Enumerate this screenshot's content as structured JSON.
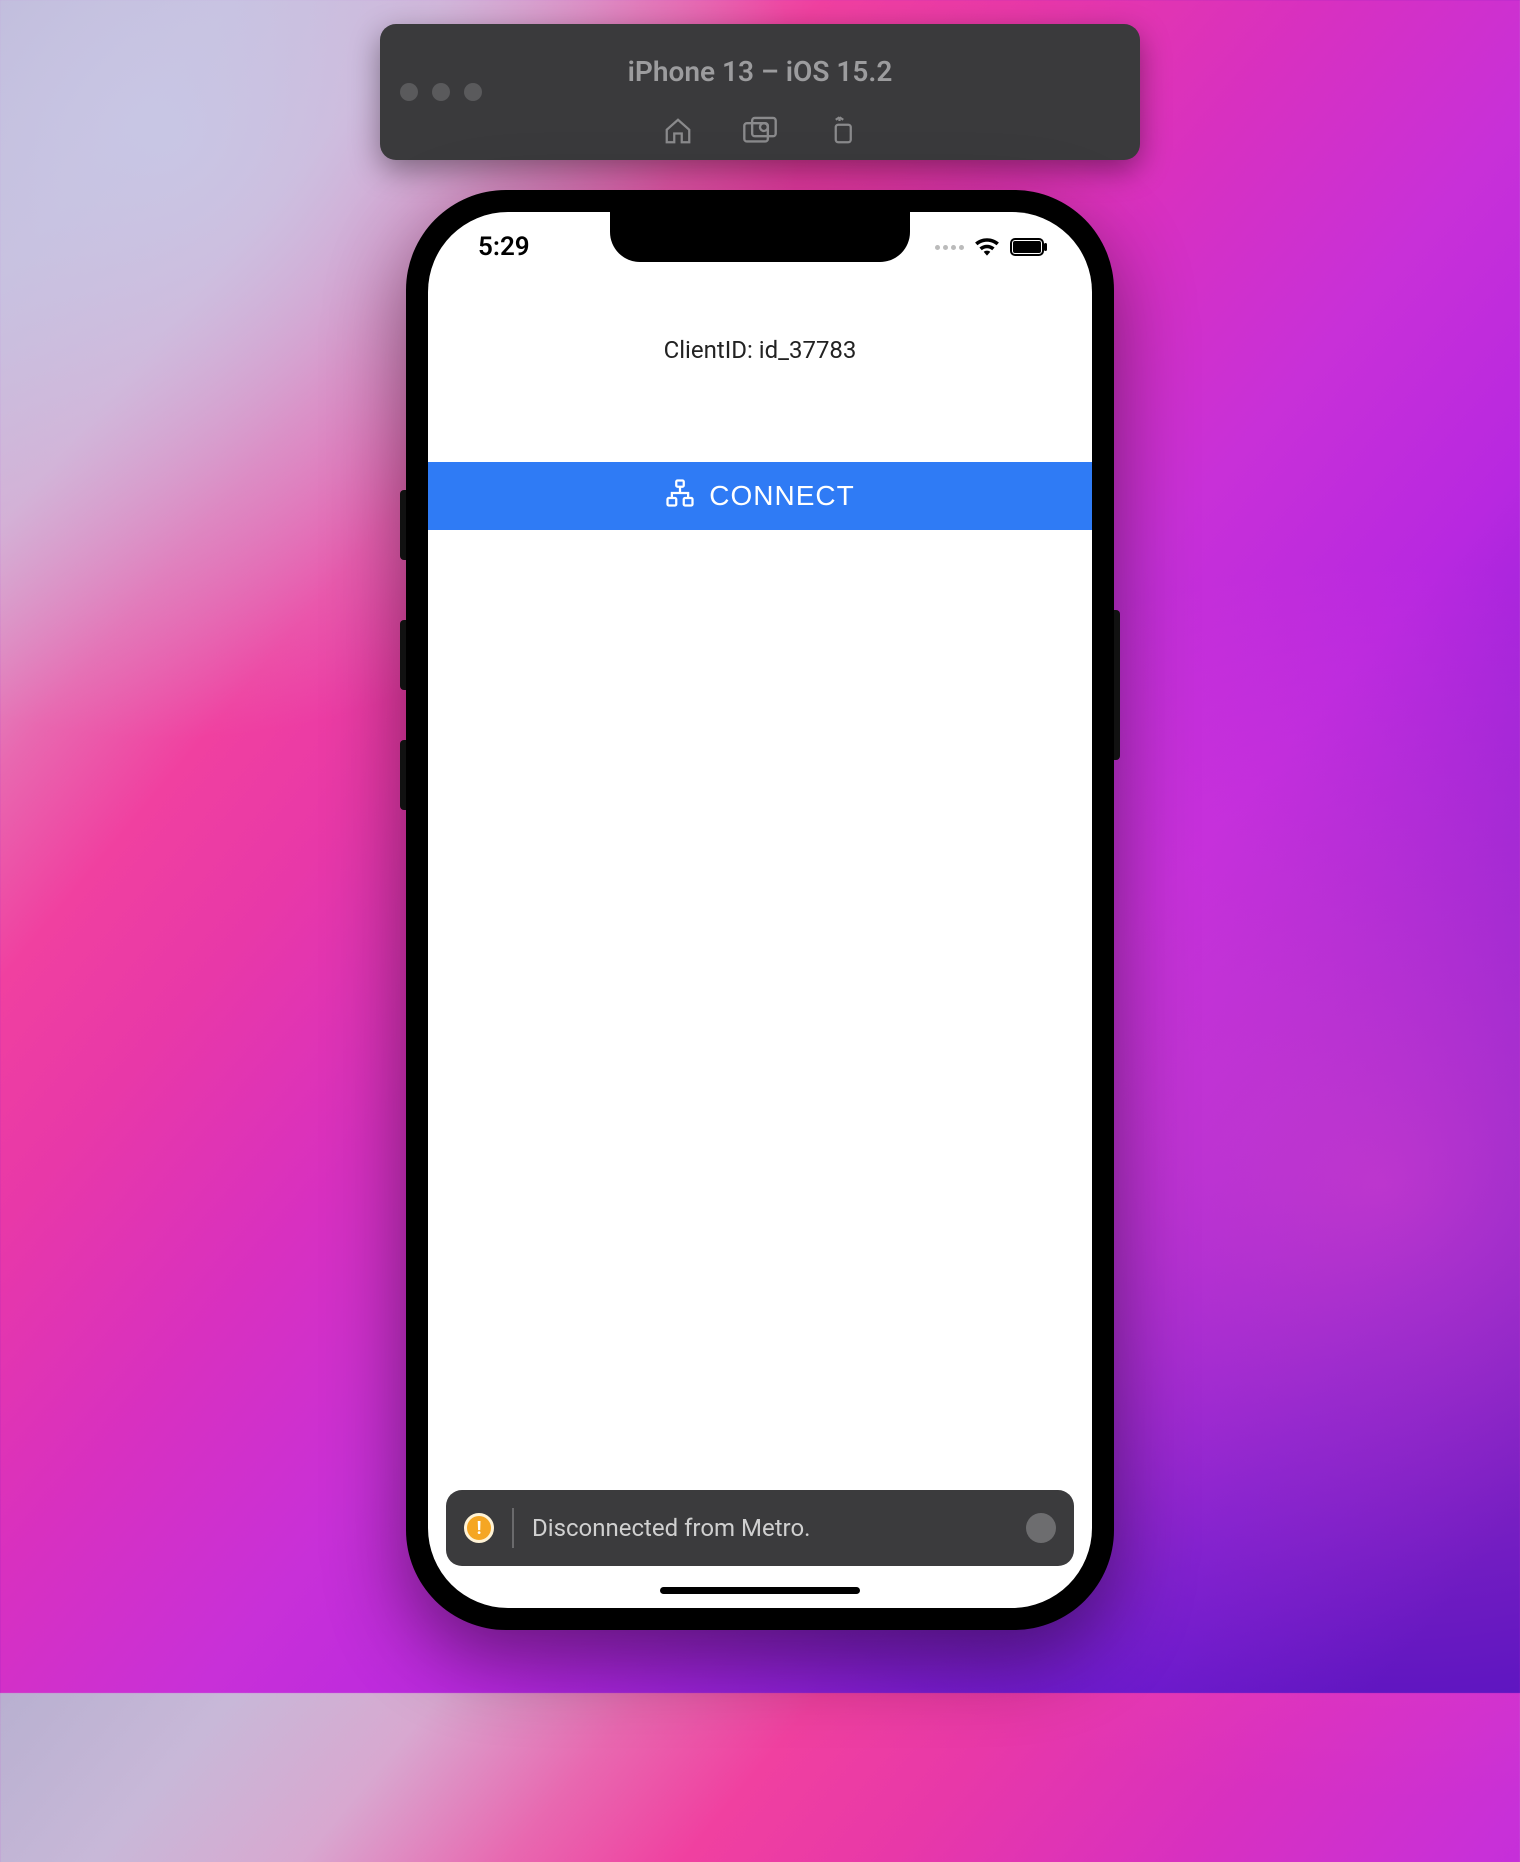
{
  "simulator": {
    "title": "iPhone 13 – iOS 15.2"
  },
  "status_bar": {
    "time": "5:29"
  },
  "app": {
    "client_id_label": "ClientID: id_37783",
    "connect_button_label": "CONNECT"
  },
  "toast": {
    "message": "Disconnected from Metro.",
    "badge_char": "!"
  }
}
